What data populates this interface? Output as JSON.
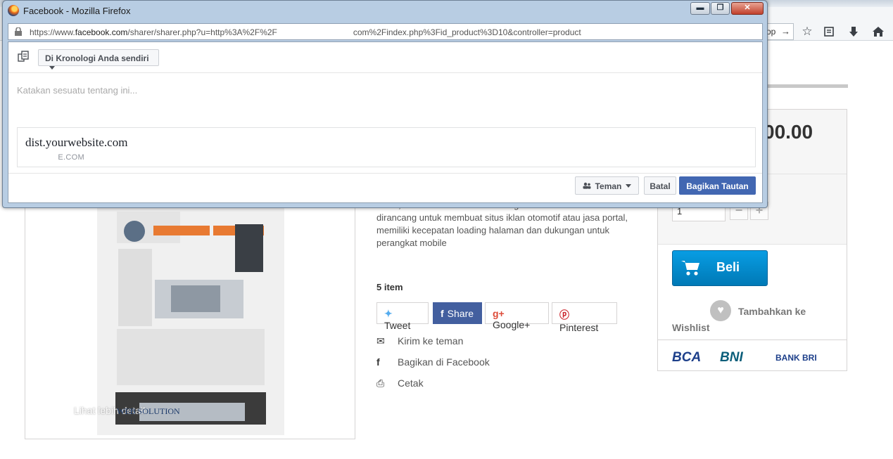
{
  "browser_bg": {
    "url_tail": "op"
  },
  "product": {
    "price_partial": "00.00",
    "quantity": "1",
    "qty_minus": "−",
    "qty_plus": "+",
    "buy_label": "Beli",
    "wishlist_line1": "Tambahkan ke",
    "wishlist_line2": "Wishlist",
    "banks": [
      "BCA",
      "BNI",
      "BANK BRI"
    ],
    "description": "mobil, desain dikombinasikan dengan ekstensi studio dan dirancang untuk membuat situs iklan otomotif atau jasa portal, memiliki kecepatan loading halaman dan dukungan untuk perangkat mobile",
    "items_count": "5 item",
    "share": {
      "tweet": "Tweet",
      "share": "Share",
      "google": "Google+",
      "pinterest": "Pinterest"
    },
    "actions": {
      "send_friend": "Kirim ke teman",
      "share_facebook": "Bagikan di Facebook",
      "print": "Cetak"
    },
    "more_link": "Lihat lebih detail",
    "watermark": "WEB SOLUTION"
  },
  "popup": {
    "window_title": "Facebook - Mozilla Firefox",
    "url_prefix": "https://www.",
    "url_domain": "facebook.com",
    "url_path_a": "/sharer/sharer.php?u=http%3A%2F%2F",
    "url_path_b": "com%2Findex.php%3Fid_product%3D10&controller=product",
    "win_minimize": "▬",
    "win_restore": "❐",
    "win_close": "✕",
    "target_dropdown": "Di Kronologi Anda sendiri",
    "composer_placeholder": "Katakan sesuatu tentang ini...",
    "link_title": "dist.yourwebsite.com",
    "link_domain": "E.COM",
    "audience_button": "Teman",
    "cancel_button": "Batal",
    "share_button": "Bagikan Tautan"
  }
}
